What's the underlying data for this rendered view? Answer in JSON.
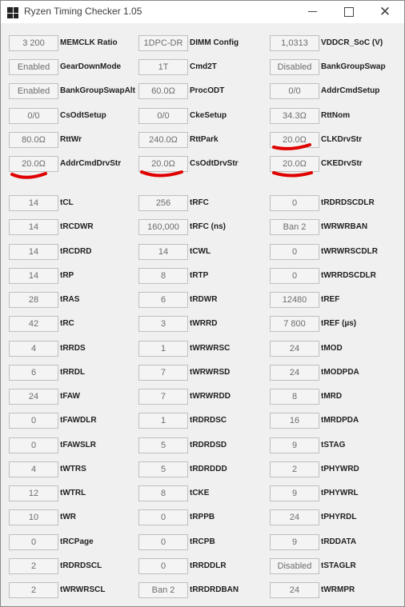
{
  "window": {
    "title": "Ryzen Timing Checker 1.05",
    "minimize_glyph": "",
    "maximize_glyph": "",
    "close_glyph": "✕",
    "icon": "app-grid-icon"
  },
  "rows": [
    [
      {
        "value": "3 200",
        "label": "MEMCLK Ratio"
      },
      {
        "value": "1DPC-DR",
        "label": "DIMM Config"
      },
      {
        "value": "1,0313",
        "label": "VDDCR_SoC (V)"
      }
    ],
    [
      {
        "value": "Enabled",
        "label": "GearDownMode"
      },
      {
        "value": "1T",
        "label": "Cmd2T"
      },
      {
        "value": "Disabled",
        "label": "BankGroupSwap"
      }
    ],
    [
      {
        "value": "Enabled",
        "label": "BankGroupSwapAlt"
      },
      {
        "value": "60.0Ω",
        "label": "ProcODT"
      },
      {
        "value": "0/0",
        "label": "AddrCmdSetup"
      }
    ],
    [
      {
        "value": "0/0",
        "label": "CsOdtSetup"
      },
      {
        "value": "0/0",
        "label": "CkeSetup"
      },
      {
        "value": "34.3Ω",
        "label": "RttNom"
      }
    ],
    [
      {
        "value": "80.0Ω",
        "label": "RttWr"
      },
      {
        "value": "240.0Ω",
        "label": "RttPark"
      },
      {
        "value": "20.0Ω",
        "label": "CLKDrvStr"
      }
    ],
    [
      {
        "value": "20.0Ω",
        "label": "AddrCmdDrvStr"
      },
      {
        "value": "20.0Ω",
        "label": "CsOdtDrvStr"
      },
      {
        "value": "20.0Ω",
        "label": "CKEDrvStr"
      }
    ],
    [
      {
        "value": "14",
        "label": "tCL"
      },
      {
        "value": "256",
        "label": "tRFC"
      },
      {
        "value": "0",
        "label": "tRDRDSCDLR"
      }
    ],
    [
      {
        "value": "14",
        "label": "tRCDWR"
      },
      {
        "value": "160,000",
        "label": "tRFC (ns)"
      },
      {
        "value": "Ban 2",
        "label": "tWRWRBAN"
      }
    ],
    [
      {
        "value": "14",
        "label": "tRCDRD"
      },
      {
        "value": "14",
        "label": "tCWL"
      },
      {
        "value": "0",
        "label": "tWRWRSCDLR"
      }
    ],
    [
      {
        "value": "14",
        "label": "tRP"
      },
      {
        "value": "8",
        "label": "tRTP"
      },
      {
        "value": "0",
        "label": "tWRRDSCDLR"
      }
    ],
    [
      {
        "value": "28",
        "label": "tRAS"
      },
      {
        "value": "6",
        "label": "tRDWR"
      },
      {
        "value": "12480",
        "label": "tREF"
      }
    ],
    [
      {
        "value": "42",
        "label": "tRC"
      },
      {
        "value": "3",
        "label": "tWRRD"
      },
      {
        "value": "7 800",
        "label": "tREF (µs)"
      }
    ],
    [
      {
        "value": "4",
        "label": "tRRDS"
      },
      {
        "value": "1",
        "label": "tWRWRSC"
      },
      {
        "value": "24",
        "label": "tMOD"
      }
    ],
    [
      {
        "value": "6",
        "label": "tRRDL"
      },
      {
        "value": "7",
        "label": "tWRWRSD"
      },
      {
        "value": "24",
        "label": "tMODPDA"
      }
    ],
    [
      {
        "value": "24",
        "label": "tFAW"
      },
      {
        "value": "7",
        "label": "tWRWRDD"
      },
      {
        "value": "8",
        "label": "tMRD"
      }
    ],
    [
      {
        "value": "0",
        "label": "tFAWDLR"
      },
      {
        "value": "1",
        "label": "tRDRDSC"
      },
      {
        "value": "16",
        "label": "tMRDPDA"
      }
    ],
    [
      {
        "value": "0",
        "label": "tFAWSLR"
      },
      {
        "value": "5",
        "label": "tRDRDSD"
      },
      {
        "value": "9",
        "label": "tSTAG"
      }
    ],
    [
      {
        "value": "4",
        "label": "tWTRS"
      },
      {
        "value": "5",
        "label": "tRDRDDD"
      },
      {
        "value": "2",
        "label": "tPHYWRD"
      }
    ],
    [
      {
        "value": "12",
        "label": "tWTRL"
      },
      {
        "value": "8",
        "label": "tCKE"
      },
      {
        "value": "9",
        "label": "tPHYWRL"
      }
    ],
    [
      {
        "value": "10",
        "label": "tWR"
      },
      {
        "value": "0",
        "label": "tRPPB"
      },
      {
        "value": "24",
        "label": "tPHYRDL"
      }
    ],
    [
      {
        "value": "0",
        "label": "tRCPage"
      },
      {
        "value": "0",
        "label": "tRCPB"
      },
      {
        "value": "9",
        "label": "tRDDATA"
      }
    ],
    [
      {
        "value": "2",
        "label": "tRDRDSCL"
      },
      {
        "value": "0",
        "label": "tRRDDLR"
      },
      {
        "value": "Disabled",
        "label": "tSTAGLR"
      }
    ],
    [
      {
        "value": "2",
        "label": "tWRWRSCL"
      },
      {
        "value": "Ban 2",
        "label": "tRRDRDBAN"
      },
      {
        "value": "24",
        "label": "tWRMPR"
      }
    ]
  ],
  "annotations": {
    "underline_color": "#e00000",
    "underlined": [
      "CLKDrvStr",
      "AddrCmdDrvStr",
      "CsOdtDrvStr",
      "CKEDrvStr"
    ]
  }
}
